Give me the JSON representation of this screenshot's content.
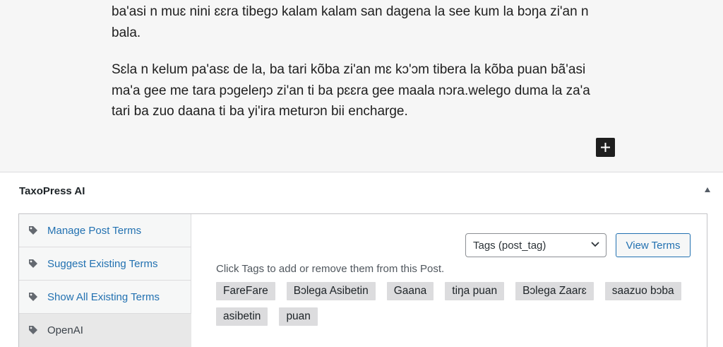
{
  "editor": {
    "paragraph1": "ba'asi n muɛ nini ɛɛra tibegɔ kalam kalam san dagena la see kum la bɔŋa zi'an n bala.",
    "paragraph2": "Sɛla n kelum pa'asɛ de la, ba tari kõba zi'an mɛ kɔ'ɔm tibera la kõba puan bã'asi ma'a gee me tara pɔgeleŋɔ zi'an ti ba pɛɛra gee maala nɔra.welego duma la za'a tari ba zuo daana ti ba yi'ira meturɔn bii encharge.",
    "inserter_icon": "plus-icon"
  },
  "metabox": {
    "title": "TaxoPress AI",
    "toggle_icon": "arrow-up-icon"
  },
  "sidebar": {
    "items": [
      {
        "label": "Manage Post Terms",
        "icon": "tag-icon"
      },
      {
        "label": "Suggest Existing Terms",
        "icon": "tag-icon"
      },
      {
        "label": "Show All Existing Terms",
        "icon": "tag-icon"
      },
      {
        "label": "OpenAI",
        "icon": "tag-icon"
      }
    ]
  },
  "main": {
    "taxonomy_select": {
      "value": "Tags (post_tag)"
    },
    "view_terms_label": "View Terms",
    "hint": "Click Tags to add or remove them from this Post.",
    "tags": [
      "FareFare",
      "Bɔlega Asibetin",
      "Gaana",
      "tiŋa puan",
      "Bɔlega Zaarɛ",
      "saazuo bɔba",
      "asibetin",
      "puan"
    ]
  },
  "colors": {
    "link": "#2271b1",
    "tag_bg": "#dcdcde",
    "editor_bg": "#f6f6f6"
  }
}
